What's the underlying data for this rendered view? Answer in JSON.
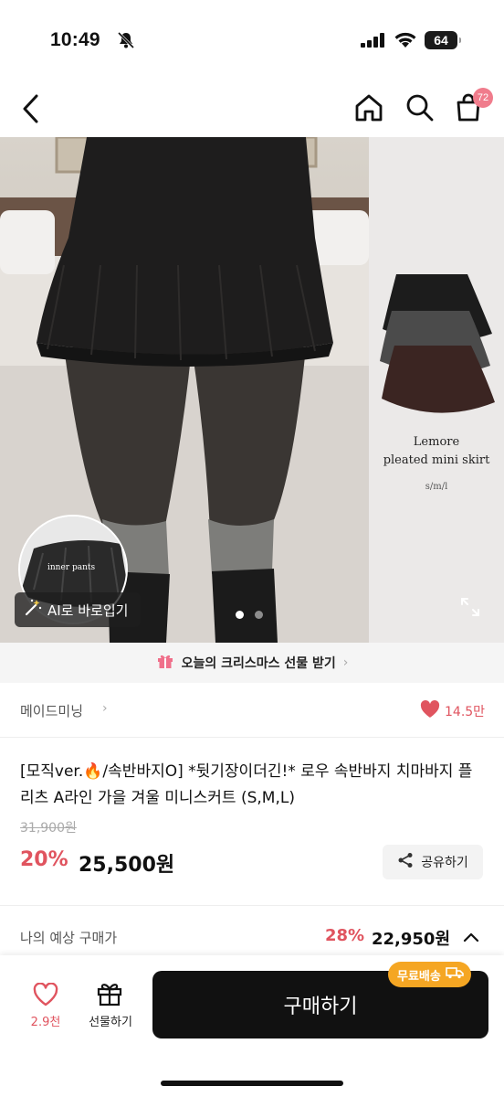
{
  "status_bar": {
    "time": "10:49",
    "battery": "64"
  },
  "nav": {
    "cart_count": "72"
  },
  "hero": {
    "product_name_line1": "Lemore",
    "product_name_line2": "pleated mini skirt",
    "sizes": "s/m/l",
    "inner_label": "inner pants",
    "ai_button": "AI로 바로입기",
    "slides": 2,
    "active_slide": 1
  },
  "gift_banner": {
    "text": "오늘의 크리스마스 선물 받기"
  },
  "brand": {
    "name": "메이드미닝",
    "likes": "14.5만"
  },
  "product": {
    "title": "[모직ver.🔥/속반바지O] *뒷기장이더긴!* 로우 속반바지 치마바지 플리츠 A라인 가을 겨울 미니스커트 (S,M,L)",
    "original_price": "31,900원",
    "discount": "20%",
    "price": "25,500원",
    "share_label": "공유하기"
  },
  "expected": {
    "label": "나의 예상 구매가",
    "discount": "28%",
    "price": "22,950원"
  },
  "bottom": {
    "wish_count": "2.9천",
    "gift_label": "선물하기",
    "buy_label": "구매하기",
    "free_shipping": "무료배송"
  },
  "colors": {
    "accent": "#e0545f",
    "badge": "#f07c8c",
    "ship": "#f5a623",
    "buy": "#111111"
  }
}
